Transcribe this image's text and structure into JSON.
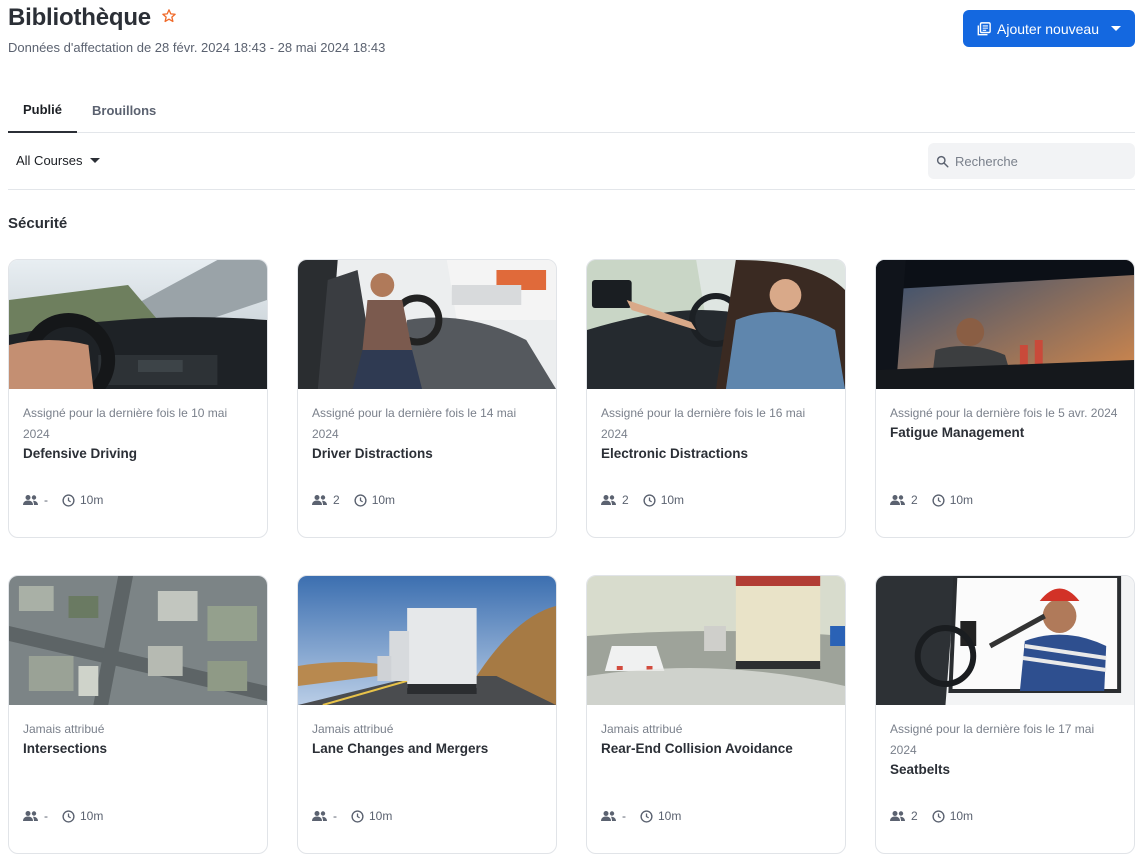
{
  "header": {
    "title": "Bibliothèque",
    "subtitle": "Données d'affectation de 28 févr. 2024 18:43 - 28 mai 2024 18:43",
    "add_button_label": "Ajouter nouveau",
    "accent_color": "#1468e0",
    "star_color": "#f06a2a"
  },
  "tabs": [
    {
      "label": "Publié",
      "active": true
    },
    {
      "label": "Brouillons",
      "active": false
    }
  ],
  "filters": {
    "course_filter_value": "All Courses",
    "search_placeholder": "Recherche"
  },
  "section": {
    "title": "Sécurité"
  },
  "cards": [
    {
      "assigned": "Assigné pour la dernière fois le 10 mai 2024",
      "name": "Defensive Driving",
      "learners": "-",
      "duration": "10m",
      "thumbnail": "truck-dashboard-road"
    },
    {
      "assigned": "Assigné pour la dernière fois le 14 mai 2024",
      "name": "Driver Distractions",
      "learners": "2",
      "duration": "10m",
      "thumbnail": "truck-driver-cab"
    },
    {
      "assigned": "Assigné pour la dernière fois le 16 mai 2024",
      "name": "Electronic Distractions",
      "learners": "2",
      "duration": "10m",
      "thumbnail": "driver-touchscreen"
    },
    {
      "assigned": "Assigné pour la dernière fois le 5 avr. 2024",
      "name": "Fatigue Management",
      "learners": "2",
      "duration": "10m",
      "thumbnail": "tired-driver-sunset"
    },
    {
      "assigned": "Jamais attribué",
      "name": "Intersections",
      "learners": "-",
      "duration": "10m",
      "thumbnail": "city-aerial"
    },
    {
      "assigned": "Jamais attribué",
      "name": "Lane Changes and Mergers",
      "learners": "-",
      "duration": "10m",
      "thumbnail": "trucks-highway"
    },
    {
      "assigned": "Jamais attribué",
      "name": "Rear-End Collision Avoidance",
      "learners": "-",
      "duration": "10m",
      "thumbnail": "foggy-road-truck"
    },
    {
      "assigned": "Assigné pour la dernière fois le 17 mai 2024",
      "name": "Seatbelts",
      "learners": "2",
      "duration": "10m",
      "thumbnail": "driver-seatbelt"
    }
  ]
}
